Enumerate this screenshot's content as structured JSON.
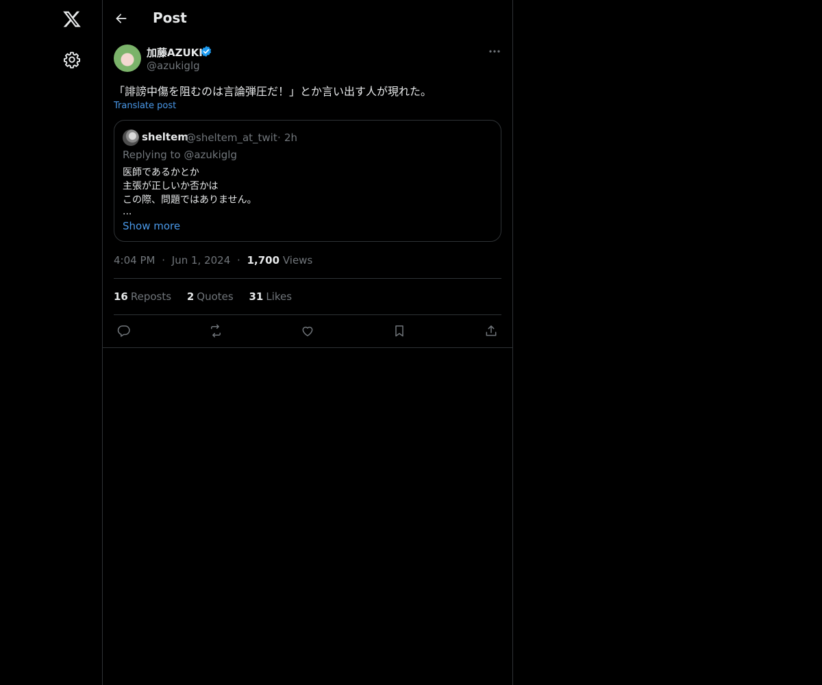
{
  "nav": {
    "logo_icon": "x-logo-icon",
    "settings_icon": "gear-icon"
  },
  "header": {
    "back_icon": "arrow-left-icon",
    "title": "Post"
  },
  "post": {
    "author_name": "加藤AZUKI",
    "verified": true,
    "author_handle": "@azukiglg",
    "text": "「誹謗中傷を阻むのは言論弾圧だ！」とか言い出す人が現れた。",
    "translate_label": "Translate post",
    "time": "4:04 PM",
    "date": "Jun 1, 2024",
    "views_count": "1,700",
    "views_label": "Views",
    "separator": "·"
  },
  "quote": {
    "name": "sheltem",
    "handle": "@sheltem_at_twit",
    "separator": "·",
    "age": "2h",
    "replying_to": "Replying to @azukiglg",
    "lines": [
      "医師であるかとか",
      "主張が正しいか否かは",
      "この際、問題ではありません。",
      "..."
    ],
    "show_more": "Show more"
  },
  "stats": {
    "reposts_count": "16",
    "reposts_label": "Reposts",
    "quotes_count": "2",
    "quotes_label": "Quotes",
    "likes_count": "31",
    "likes_label": "Likes"
  },
  "actions": [
    "reply-icon",
    "repost-icon",
    "like-icon",
    "bookmark-icon",
    "share-icon"
  ],
  "colors": {
    "background": "#000000",
    "text": "#e7e9ea",
    "secondary": "#71767b",
    "link": "#4a99e9",
    "border": "#2f3336",
    "verified": "#1d9bf0"
  }
}
